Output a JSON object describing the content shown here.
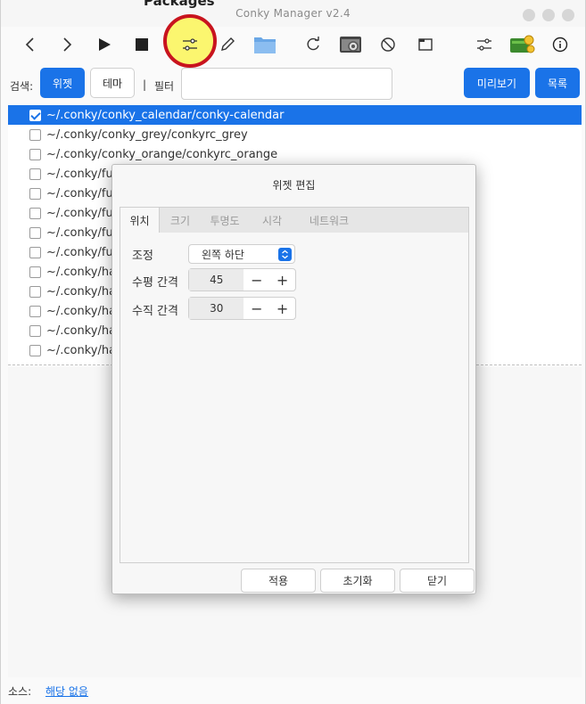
{
  "window": {
    "title": "Conky Manager v2.4",
    "behind_title": "Packages"
  },
  "toolbar": {
    "icons": [
      "back-icon",
      "forward-icon",
      "play-icon",
      "stop-icon",
      "sliders-icon",
      "pencil-icon",
      "folder-icon",
      "refresh-icon",
      "screenshot-settings-icon",
      "block-icon",
      "window-icon",
      "settings-sliders-icon",
      "donate-icon",
      "info-icon"
    ],
    "highlight_color": "#fbf66f",
    "highlight_ring": "#c8141e"
  },
  "search": {
    "label": "검색:",
    "widget_button": "위젯",
    "theme_button": "테마",
    "separator": "|",
    "filter_label": "필터",
    "filter_value": "",
    "preview_button": "미리보기",
    "list_button": "목록"
  },
  "list": {
    "items": [
      {
        "text": "~/.conky/conky_calendar/conky-calendar",
        "checked": true,
        "selected": true
      },
      {
        "text": "~/.conky/conky_grey/conkyrc_grey",
        "checked": false,
        "selected": false
      },
      {
        "text": "~/.conky/conky_orange/conkyrc_orange",
        "checked": false,
        "selected": false
      },
      {
        "text": "~/.conky/fut",
        "checked": false,
        "selected": false
      },
      {
        "text": "~/.conky/fut",
        "checked": false,
        "selected": false
      },
      {
        "text": "~/.conky/fut",
        "checked": false,
        "selected": false
      },
      {
        "text": "~/.conky/fut",
        "checked": false,
        "selected": false
      },
      {
        "text": "~/.conky/fut",
        "checked": false,
        "selected": false
      },
      {
        "text": "~/.conky/har",
        "checked": false,
        "selected": false
      },
      {
        "text": "~/.conky/har",
        "checked": false,
        "selected": false
      },
      {
        "text": "~/.conky/har",
        "checked": false,
        "selected": false
      },
      {
        "text": "~/.conky/har",
        "checked": false,
        "selected": false
      },
      {
        "text": "~/.conky/har",
        "checked": false,
        "selected": false
      }
    ]
  },
  "status": {
    "source_label": "소스:",
    "source_value": "해당 없음"
  },
  "dialog": {
    "title": "위젯 편집",
    "tabs": [
      "위치",
      "크기",
      "투명도",
      "시각",
      "네트워크"
    ],
    "active_tab": "위치",
    "alignment_label": "조정",
    "alignment_value": "왼쪽 하단",
    "hgap_label": "수평 간격",
    "hgap_value": "45",
    "vgap_label": "수직 간격",
    "vgap_value": "30",
    "minus": "−",
    "plus": "+",
    "apply_button": "적용",
    "reset_button": "초기화",
    "close_button": "닫기"
  },
  "colors": {
    "accent": "#1a73e8"
  }
}
